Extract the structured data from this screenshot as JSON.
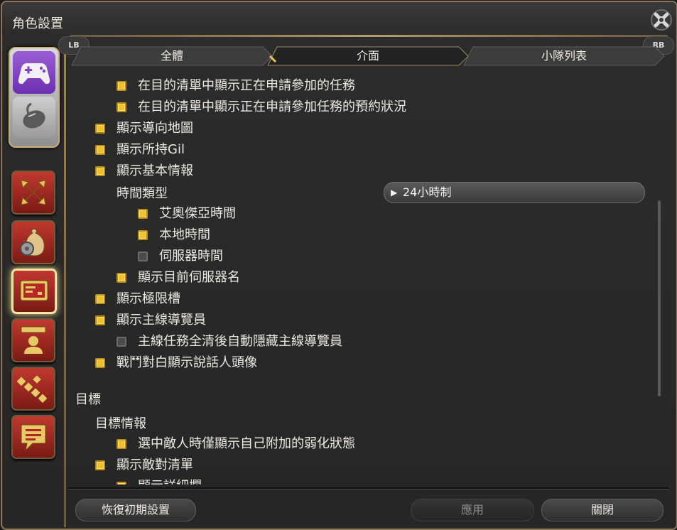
{
  "window": {
    "title": "角色設置"
  },
  "tabs": [
    {
      "label": "全體"
    },
    {
      "label": "介面"
    },
    {
      "label": "小隊列表"
    }
  ],
  "shoulder": {
    "left": "LB",
    "right": "RB"
  },
  "settings": [
    {
      "label": "在目的清單中顯示正在申請參加的任務",
      "checked": true
    },
    {
      "label": "在目的清單中顯示正在申請參加任務的預約狀況",
      "checked": true
    },
    {
      "label": "顯示導向地圖",
      "checked": true
    },
    {
      "label": "顯示所持Gil",
      "checked": true
    },
    {
      "label": "顯示基本情報",
      "checked": true
    },
    {
      "label": "時間類型"
    },
    {
      "label": "艾奧傑亞時間",
      "checked": true
    },
    {
      "label": "本地時間",
      "checked": true
    },
    {
      "label": "伺服器時間",
      "checked": false
    },
    {
      "label": "顯示目前伺服器名",
      "checked": true
    },
    {
      "label": "顯示極限槽",
      "checked": true
    },
    {
      "label": "顯示主線導覽員",
      "checked": true
    },
    {
      "label": "主線任務全清後自動隱藏主線導覽員",
      "checked": false
    },
    {
      "label": "戰鬥對白顯示說話人頭像",
      "checked": true
    },
    {
      "label": "目標"
    },
    {
      "label": "目標情報"
    },
    {
      "label": "選中敵人時僅顯示自己附加的弱化狀態",
      "checked": true
    },
    {
      "label": "顯示敵對清單",
      "checked": true
    },
    {
      "label": "顯示詳細欄",
      "checked": true
    }
  ],
  "time_select": {
    "value": "24小時制",
    "arrow": "▶"
  },
  "buttons": {
    "reset": "恢復初期設置",
    "apply": "應用",
    "close": "關閉"
  },
  "colors": {
    "checked": "#f4bf2c",
    "accent_border": "#8a7656",
    "tab_active": "#2a2a2a"
  }
}
